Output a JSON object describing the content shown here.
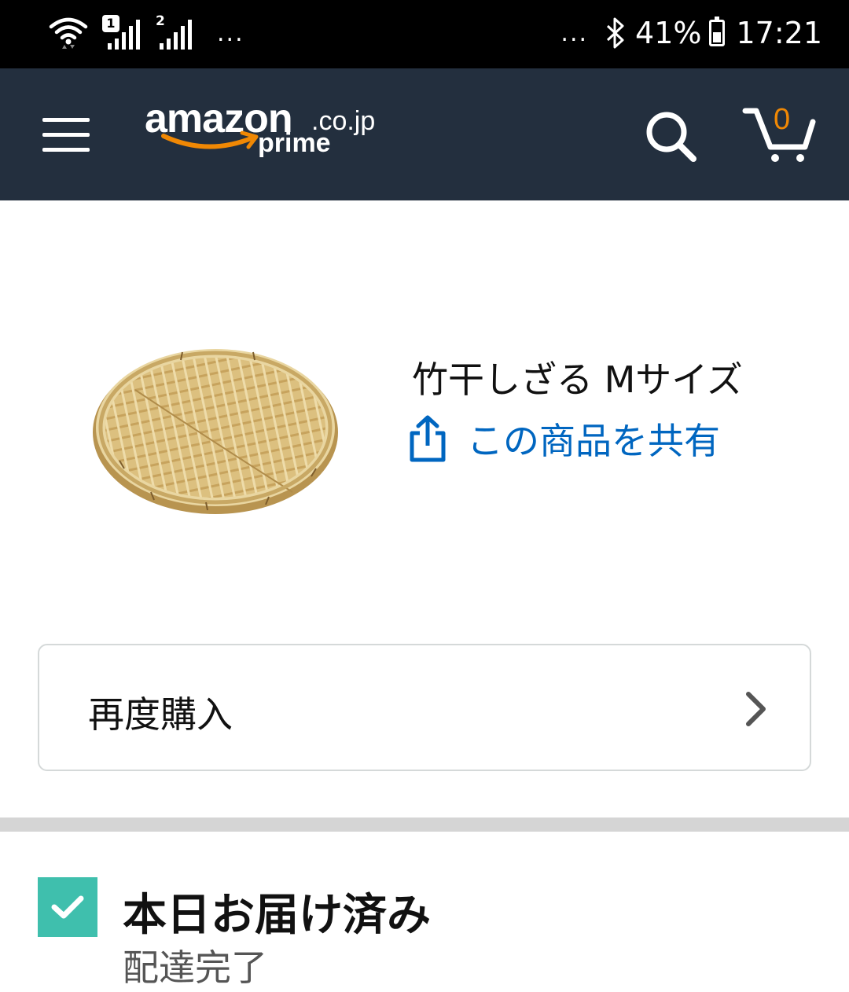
{
  "status_bar": {
    "sim1_label": "1",
    "sim2_label": "2",
    "left_dots": "...",
    "right_dots": "...",
    "battery": "41%",
    "time": "17:21",
    "icons": [
      "wifi-icon",
      "signal-icon",
      "bluetooth-icon",
      "battery-icon"
    ]
  },
  "header": {
    "logo_word": "amazon",
    "logo_tld": ".co.jp",
    "logo_prime": "prime",
    "cart_count": "0",
    "icons": [
      "menu-icon",
      "search-icon",
      "cart-icon"
    ],
    "colors": {
      "background": "#232f3e",
      "accent": "#f08804"
    }
  },
  "product": {
    "title": "竹干しざる Mサイズ",
    "share_label": "この商品を共有",
    "image": "bamboo-basket-image",
    "colors": {
      "link": "#0066c0"
    }
  },
  "buy_again": {
    "label": "再度購入",
    "icon": "chevron-right-icon"
  },
  "delivery": {
    "title": "本日お届け済み",
    "subtitle": "配達完了",
    "icon": "checkmark-icon",
    "colors": {
      "check": "#3fbfad"
    }
  }
}
